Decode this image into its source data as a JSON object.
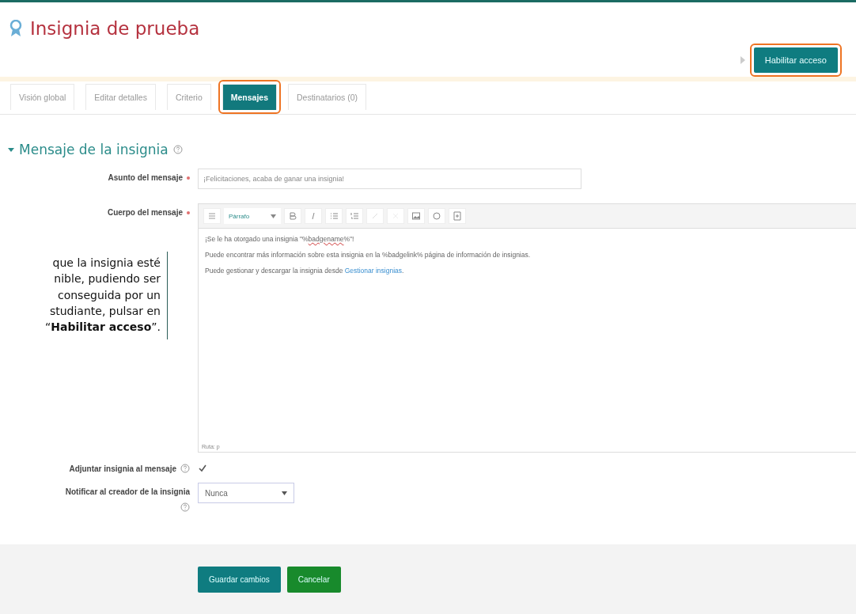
{
  "page_title": "Insignia de prueba",
  "header_button": {
    "label": "Habilitar acceso",
    "highlighted": true
  },
  "tabs": [
    {
      "label": "Visión global",
      "selected": false,
      "highlighted": false
    },
    {
      "label": "Editar detalles",
      "selected": false,
      "highlighted": false
    },
    {
      "label": "Criterio",
      "selected": false,
      "highlighted": false
    },
    {
      "label": "Mensajes",
      "selected": true,
      "highlighted": true
    },
    {
      "label": "Destinatarios (0)",
      "selected": false,
      "highlighted": false
    }
  ],
  "section": {
    "title": "Mensaje de la insignia",
    "expanded": true
  },
  "subject": {
    "label": "Asunto del mensaje",
    "required": true,
    "value": "¡Felicitaciones, acaba de ganar una insignia!"
  },
  "body": {
    "label": "Cuerpo del mensaje",
    "required": true,
    "paragraph_style": "Párrafo",
    "lines": [
      {
        "parts": [
          {
            "text": "¡Se le ha otorgado una insignia \"%",
            "misspelled": false
          },
          {
            "text": "badgename",
            "misspelled": true
          },
          {
            "text": "%\"!",
            "misspelled": false
          }
        ]
      },
      {
        "text": "Puede encontrar más información sobre esta insignia en la %badgelink% página de información de insignias."
      },
      {
        "text": "Puede gestionar y descargar la insignia desde ",
        "link": "Gestionar insignias",
        "after": "."
      }
    ],
    "path": "Ruta: p"
  },
  "callout": {
    "lines": [
      "que la insignia esté",
      "nible, pudiendo ser",
      "conseguida por un",
      "studiante, pulsar en",
      "“**Habilitar acceso**”."
    ]
  },
  "attach": {
    "label": "Adjuntar insignia al mensaje",
    "checked": true
  },
  "notify": {
    "label": "Notificar al creador de la insignia",
    "value": "Nunca"
  },
  "buttons": [
    {
      "label": "Guardar cambios",
      "kind": "primary"
    },
    {
      "label": "Cancelar",
      "kind": "cancel"
    }
  ]
}
